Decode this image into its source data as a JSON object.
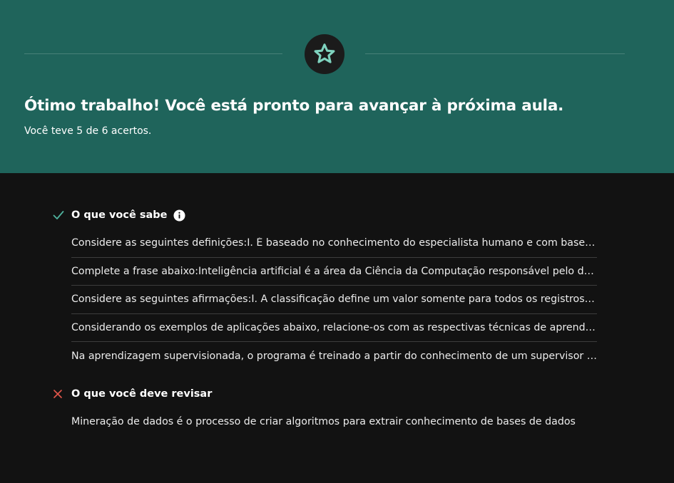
{
  "colors": {
    "banner": "#1f645b",
    "background": "#121212",
    "accent_star": "#7fd3bf",
    "check": "#4fb39e",
    "cross": "#e0554a"
  },
  "result": {
    "icon": "star-icon",
    "headline": "Ótimo trabalho! Você está pronto para avançar à próxima aula.",
    "score_text": "Você teve 5 de 6 acertos."
  },
  "known": {
    "icon": "check-icon",
    "title": "O que você sabe",
    "info_icon": "info-icon",
    "items": [
      "Considere as seguintes definições:I. É baseado no conhecimento do especialista humano e com base nessas regras",
      "Complete a frase abaixo:Inteligência artificial é a área da Ciência da Computação responsável pelo desenvolvimento",
      "Considere as seguintes afirmações:I. A classificação define um valor somente para todos os registros da base",
      "Considerando os exemplos de aplicações abaixo, relacione-os com as respectivas técnicas de aprendizado",
      "Na aprendizagem supervisionada, o programa é treinado a partir do conhecimento de um supervisor humano"
    ]
  },
  "review": {
    "icon": "x-icon",
    "title": "O que você deve revisar",
    "items": [
      "Mineração de dados é o processo de criar algoritmos para extrair conhecimento de bases de dados"
    ]
  }
}
